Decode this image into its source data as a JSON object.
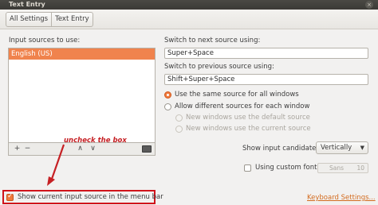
{
  "window": {
    "title": "Text Entry",
    "close_glyph": "×"
  },
  "breadcrumbs": [
    "All Settings",
    "Text Entry"
  ],
  "input_sources": {
    "label": "Input sources to use:",
    "items": [
      "English (US)"
    ],
    "selected_index": 0,
    "toolbar": {
      "add": "+",
      "remove": "−",
      "up": "∧",
      "down": "∨"
    }
  },
  "switch_next": {
    "label": "Switch to next source using:",
    "value": "Super+Space"
  },
  "switch_prev": {
    "label": "Switch to previous source using:",
    "value": "Shift+Super+Space"
  },
  "source_scope": {
    "same": {
      "label": "Use the same source for all windows",
      "checked": true
    },
    "different": {
      "label": "Allow different sources for each window",
      "checked": false
    },
    "default_src": {
      "label": "New windows use the default source",
      "checked": false
    },
    "current_src": {
      "label": "New windows use the current source",
      "checked": true
    }
  },
  "candidates": {
    "label": "Show input candidates:",
    "value": "Vertically",
    "arrow": "▼"
  },
  "custom_font": {
    "label": "Using custom font:",
    "checked": false,
    "font_name": "Sans",
    "font_size": "10"
  },
  "show_current": {
    "label": "Show current input source in the menu bar",
    "checked": true
  },
  "annotation": {
    "text": "uncheck the box",
    "color": "#c62024"
  },
  "keyboard_settings_link": "Keyboard Settings...",
  "colors": {
    "accent": "#f07a3d",
    "highlight_border": "#d0141b",
    "titlebar": "#3b3a36"
  }
}
